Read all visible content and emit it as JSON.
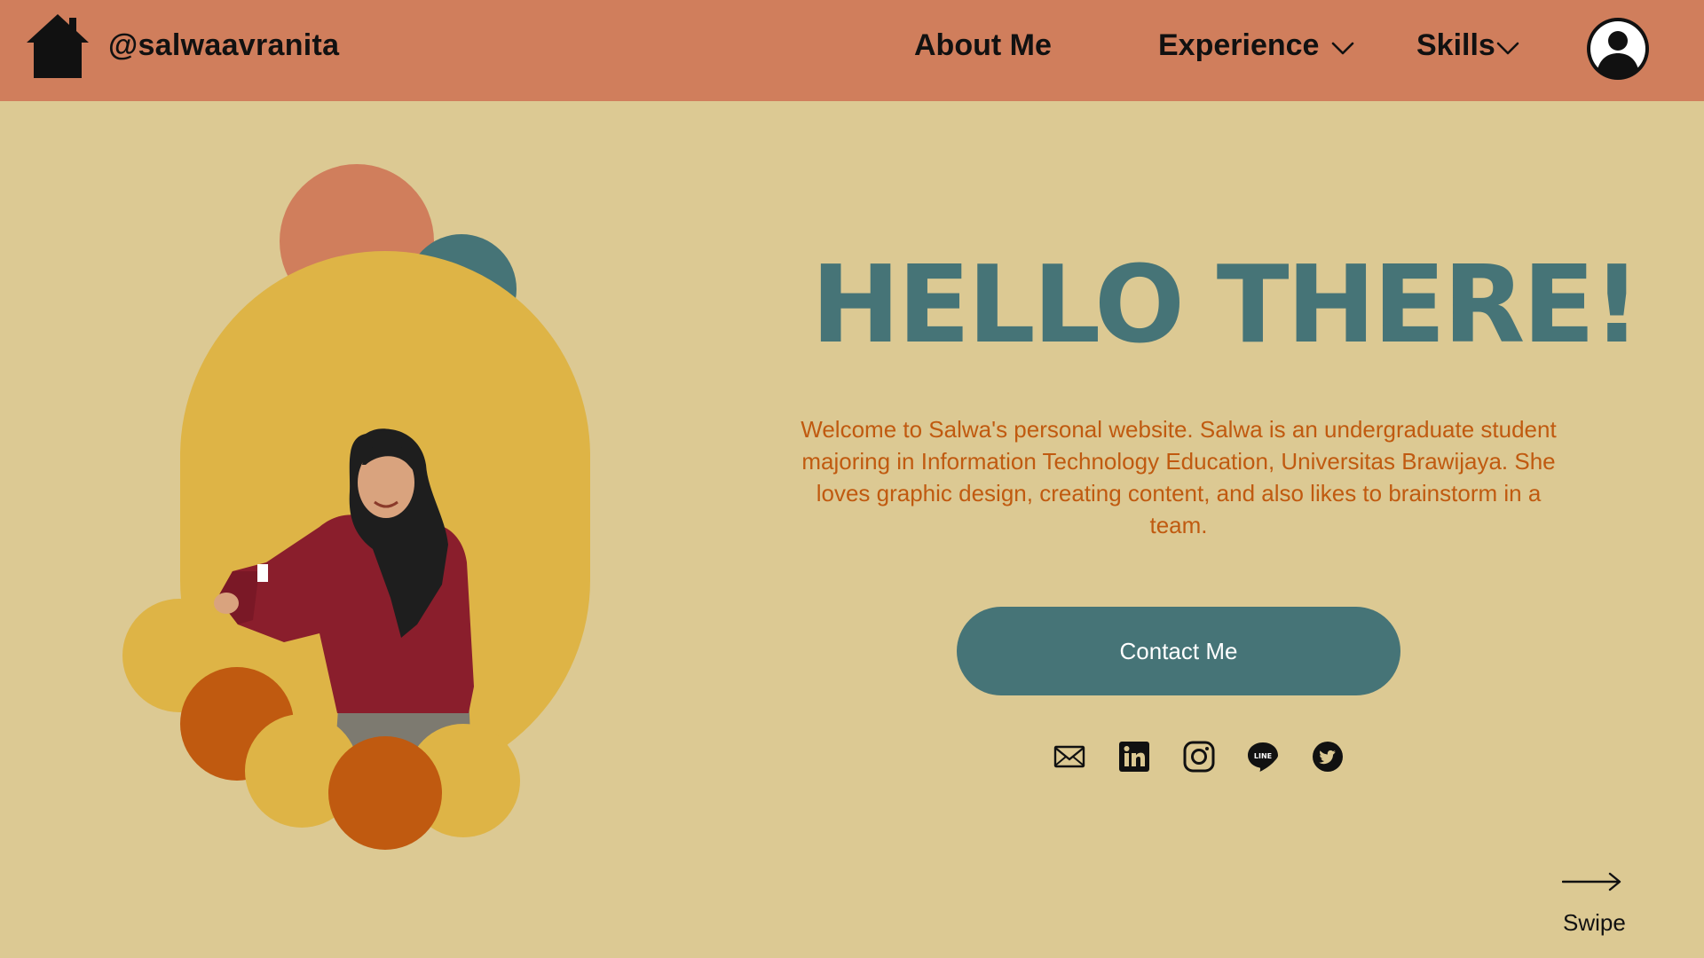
{
  "header": {
    "handle": "@salwaavranita",
    "nav": {
      "about": "About Me",
      "experience": "Experience",
      "skills": "Skills"
    }
  },
  "hero": {
    "title": "HELLO THERE!",
    "intro": "Welcome to Salwa's personal website. Salwa is an undergraduate student majoring in Information Technology Education, Universitas Brawijaya. She loves graphic design, creating content, and also likes to brainstorm in a team.",
    "contact_button": "Contact Me"
  },
  "social_icons": [
    "mail-icon",
    "linkedin-icon",
    "instagram-icon",
    "line-icon",
    "twitter-icon"
  ],
  "swipe": {
    "label": "Swipe"
  },
  "colors": {
    "header_bg": "#D07E5C",
    "page_bg": "#DCC993",
    "title": "#467477",
    "intro_text": "#C05A10",
    "button_bg": "#467477",
    "yellow_shape": "#DEB446",
    "orange_shape": "#C05A10"
  }
}
